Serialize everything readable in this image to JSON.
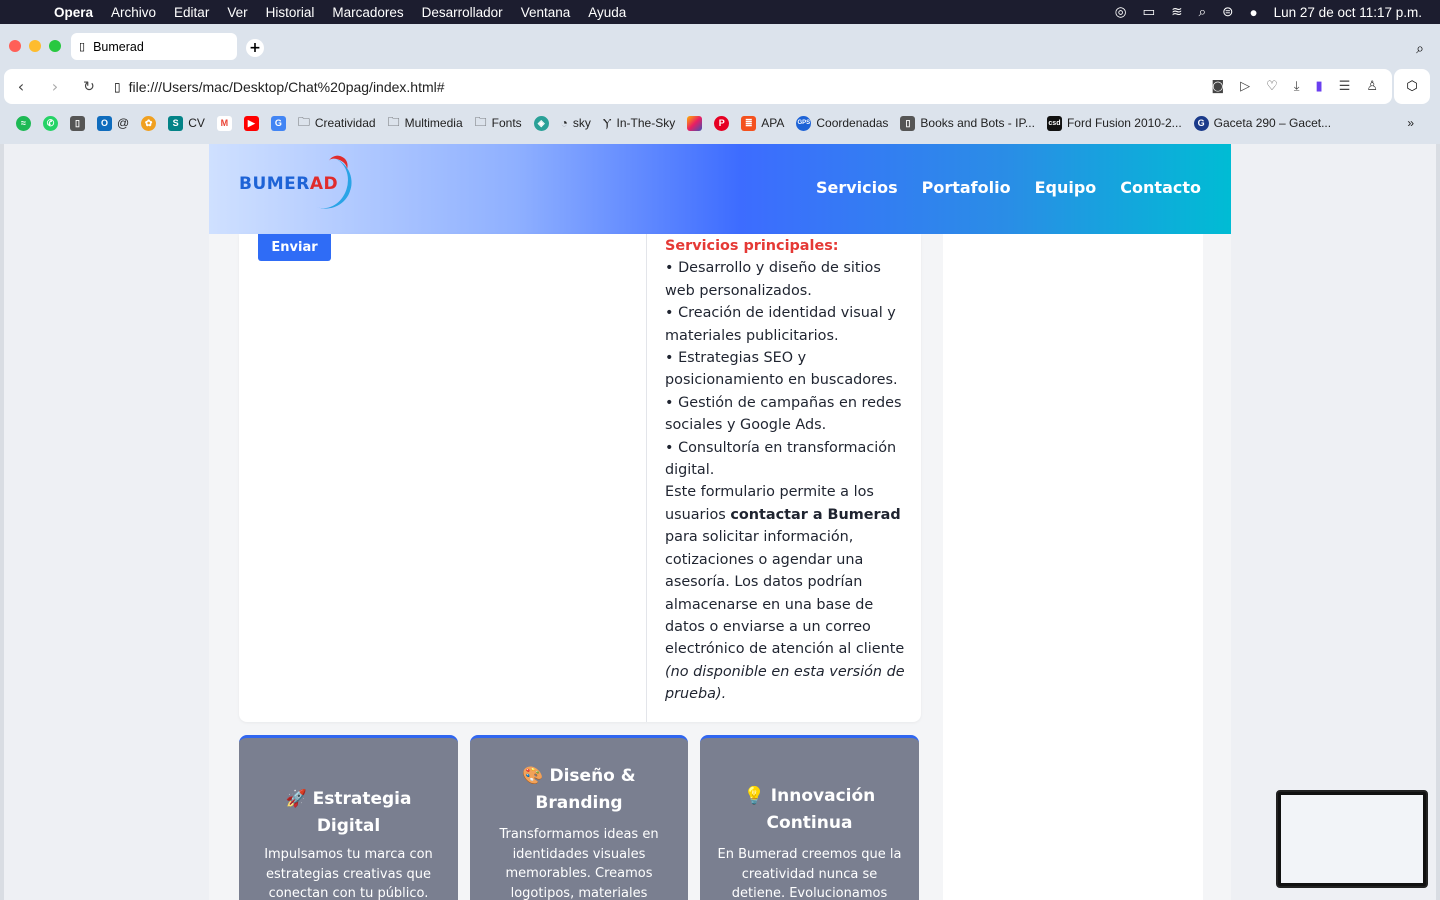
{
  "menubar": {
    "app": "Opera",
    "items": [
      "Archivo",
      "Editar",
      "Ver",
      "Historial",
      "Marcadores",
      "Desarrollador",
      "Ventana",
      "Ayuda"
    ],
    "datetime": "Lun 27 de oct  11:17 p.m."
  },
  "browser": {
    "tab_title": "Bumerad",
    "url": "file:///Users/mac/Desktop/Chat%20pag/index.html#",
    "bookmarks": [
      {
        "label": "",
        "icon": "spotify-icon",
        "color": "#1db954"
      },
      {
        "label": "",
        "icon": "whatsapp-icon",
        "color": "#25d366"
      },
      {
        "label": "",
        "icon": "doc-icon",
        "color": "#555"
      },
      {
        "label": "@",
        "icon": "outlook-icon",
        "color": "#0f6cbd"
      },
      {
        "label": "",
        "icon": "photos-icon",
        "color": "#f0a020"
      },
      {
        "label": "CV",
        "icon": "sharepoint-icon",
        "color": "#038387"
      },
      {
        "label": "",
        "icon": "gmail-icon",
        "color": "#ea4335"
      },
      {
        "label": "",
        "icon": "youtube-icon",
        "color": "#ff0000"
      },
      {
        "label": "",
        "icon": "translate-icon",
        "color": "#4285f4"
      },
      {
        "label": "Creatividad",
        "icon": "folder-icon",
        "color": ""
      },
      {
        "label": "Multimedia",
        "icon": "folder-icon",
        "color": ""
      },
      {
        "label": "Fonts",
        "icon": "folder-icon",
        "color": ""
      },
      {
        "label": "",
        "icon": "shield-icon",
        "color": "#2aa198"
      },
      {
        "label": "sky",
        "icon": "gauge-icon",
        "color": "#666"
      },
      {
        "label": "In-The-Sky",
        "icon": "telescope-icon",
        "color": "#333"
      },
      {
        "label": "",
        "icon": "color-icon",
        "color": "#e91e63"
      },
      {
        "label": "",
        "icon": "pinterest-icon",
        "color": "#e60023"
      },
      {
        "label": "APA",
        "icon": "apa-icon",
        "color": "#f4511e"
      },
      {
        "label": "Coordenadas",
        "icon": "gps-icon",
        "color": "#1e63d6"
      },
      {
        "label": "Books and Bots - IP...",
        "icon": "doc-icon",
        "color": "#555"
      },
      {
        "label": "Ford Fusion 2010-2...",
        "icon": "csd-icon",
        "color": "#111"
      },
      {
        "label": "Gaceta 290 – Gacet...",
        "icon": "gaceta-icon",
        "color": "#1a3a8a"
      }
    ]
  },
  "site": {
    "logo": {
      "part1": "BUMER",
      "part2": "AD"
    },
    "nav": [
      "Servicios",
      "Portafolio",
      "Equipo",
      "Contacto"
    ],
    "send_button": "Enviar",
    "services_heading": "Servicios principales:",
    "services": [
      "• Desarrollo y diseño de sitios web personalizados.",
      "• Creación de identidad visual y materiales publicitarios.",
      "• Estrategias SEO y posicionamiento en buscadores.",
      "• Gestión de campañas en redes sociales y Google Ads.",
      "• Consultoría en transformación digital."
    ],
    "note_start": "Este formulario permite a los usuarios ",
    "note_bold": "contactar a Bumerad",
    "note_mid": " para solicitar información, cotizaciones o agendar una asesoría. Los datos podrían almacenarse en una base de datos o enviarse a un correo electrónico de atención al cliente ",
    "note_italic": "(no disponible en esta versión de prueba).",
    "cards": [
      {
        "title": "🚀 Estrategia Digital",
        "desc": "Impulsamos tu marca con estrategias creativas que conectan con tu público. Desde redes sociales hasta"
      },
      {
        "title": "🎨 Diseño & Branding",
        "desc": "Transformamos ideas en identidades visuales memorables. Creamos logotipos, materiales"
      },
      {
        "title": "💡 Innovación Continua",
        "desc": "En Bumerad creemos que la creatividad nunca se detiene. Evolucionamos"
      }
    ]
  },
  "colors": {
    "accent": "#2f6cf6",
    "heading_red": "#e53935",
    "card_bg": "#7a7f90"
  }
}
